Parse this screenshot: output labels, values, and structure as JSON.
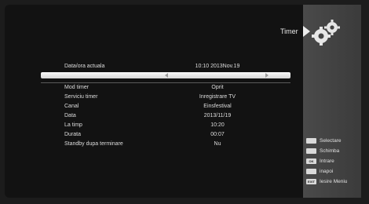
{
  "header": {
    "title": "Timer",
    "icon": "gear-icon"
  },
  "current_datetime": {
    "label": "Data/ora actuala",
    "value": "10:10 2013Nov.19"
  },
  "settings": [
    {
      "label": "Mod timer",
      "value": "Oprit"
    },
    {
      "label": "Serviciu timer",
      "value": "Inregistrare TV"
    },
    {
      "label": "Canal",
      "value": "Einsfestival"
    },
    {
      "label": "Data",
      "value": "2013/11/19"
    },
    {
      "label": "La timp",
      "value": "10:20"
    },
    {
      "label": "Durata",
      "value": "00:07"
    },
    {
      "label": "Standby dupa terminare",
      "value": "Nu"
    }
  ],
  "legend": [
    {
      "key": "",
      "label": "Selectare"
    },
    {
      "key": "",
      "label": "Schimba"
    },
    {
      "key": "OK",
      "label": "Intrare"
    },
    {
      "key": "",
      "label": "inapoi"
    },
    {
      "key": "EXIT",
      "label": "Iesire Meniu"
    }
  ]
}
